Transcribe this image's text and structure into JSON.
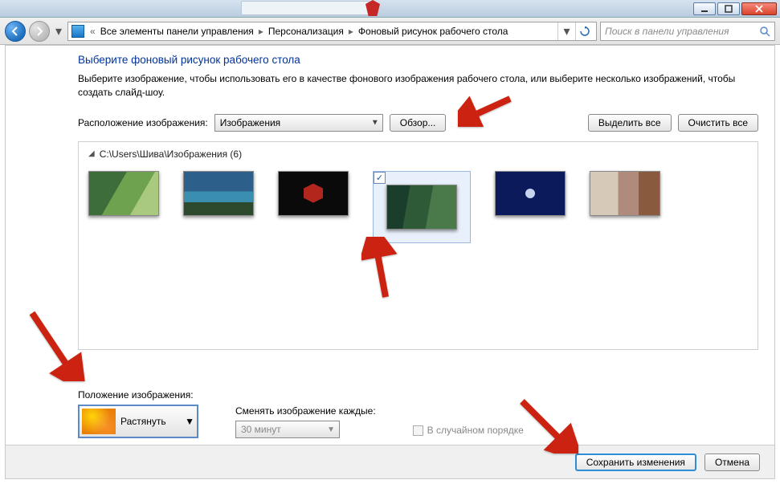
{
  "titlebar": {
    "minimize": "minimize",
    "maximize": "maximize",
    "close": "close"
  },
  "nav": {
    "crumb1": "Все элементы панели управления",
    "crumb2": "Персонализация",
    "crumb3": "Фоновый рисунок рабочего стола",
    "search_placeholder": "Поиск в панели управления"
  },
  "page": {
    "heading": "Выберите фоновый рисунок рабочего стола",
    "subtext": "Выберите изображение, чтобы использовать его в качестве фонового изображения рабочего стола, или выберите несколько изображений, чтобы создать слайд-шоу.",
    "location_label": "Расположение изображения:",
    "location_value": "Изображения",
    "browse": "Обзор...",
    "select_all": "Выделить все",
    "clear_all": "Очистить все",
    "folder_path": "C:\\Users\\Шива\\Изображения (6)"
  },
  "position": {
    "label": "Положение изображения:",
    "value": "Растянуть"
  },
  "interval": {
    "label": "Сменять изображение каждые:",
    "value": "30 минут"
  },
  "shuffle_label": "В случайном порядке",
  "footer": {
    "save": "Сохранить изменения",
    "cancel": "Отмена"
  }
}
